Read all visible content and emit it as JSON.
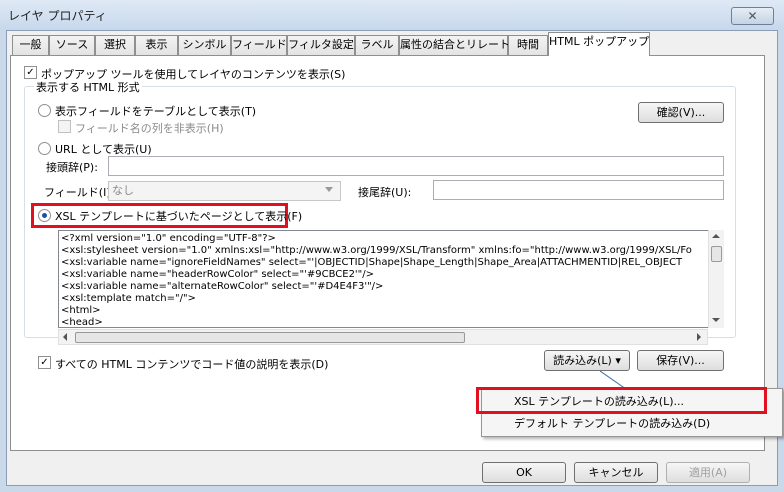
{
  "window": {
    "title": "レイヤ プロパティ",
    "close_glyph": "✕"
  },
  "tabs": [
    "一般",
    "ソース",
    "選択",
    "表示",
    "シンボル",
    "フィールド",
    "フィルタ設定",
    "ラベル",
    "属性の結合とリレート",
    "時間",
    "HTML ポップアップ"
  ],
  "active_tab": "HTML ポップアップ",
  "popup_tool": {
    "label": "ポップアップ ツールを使用してレイヤのコンテンツを表示(S)",
    "checked": true
  },
  "format_group": {
    "label": "表示する HTML 形式"
  },
  "option_table": {
    "label": "表示フィールドをテーブルとして表示(T)",
    "selected": false
  },
  "hide_fieldname": {
    "label": "フィールド名の列を非表示(H)",
    "checked": false,
    "disabled": true
  },
  "verify_button": "確認(V)...",
  "option_url": {
    "label": "URL として表示(U)",
    "selected": false
  },
  "prefix": {
    "label": "接頭辞(P):",
    "value": ""
  },
  "field": {
    "label": "フィールド(I):",
    "value": "なし"
  },
  "suffix": {
    "label": "接尾辞(U):",
    "value": ""
  },
  "option_xsl": {
    "label": "XSL テンプレートに基づいたページとして表示(F)",
    "selected": true
  },
  "xsl_code": [
    "<?xml version=\"1.0\" encoding=\"UTF-8\"?>",
    "<xsl:stylesheet version=\"1.0\" xmlns:xsl=\"http://www.w3.org/1999/XSL/Transform\" xmlns:fo=\"http://www.w3.org/1999/XSL/Fo",
    "  <xsl:variable name=\"ignoreFieldNames\" select=\"'|OBJECTID|Shape|Shape_Length|Shape_Area|ATTACHMENTID|REL_OBJECT",
    "  <xsl:variable name=\"headerRowColor\" select=\"'#9CBCE2'\"/>",
    "  <xsl:variable name=\"alternateRowColor\" select=\"'#D4E4F3'\"/>",
    "  <xsl:template match=\"/\">",
    "    <html>",
    "      <head>"
  ],
  "coded_values": {
    "label": "すべての HTML コンテンツでコード値の説明を表示(D)",
    "checked": true
  },
  "load_button": "読み込み(L)",
  "save_button": "保存(V)...",
  "load_menu": [
    "XSL テンプレートの読み込み(L)...",
    "デフォルト テンプレートの読み込み(D)"
  ],
  "footer": {
    "ok": "OK",
    "cancel": "キャンセル",
    "apply": "適用(A)"
  },
  "colors": {
    "highlight": "#e0101e",
    "radio_dot": "#1b52a8"
  }
}
